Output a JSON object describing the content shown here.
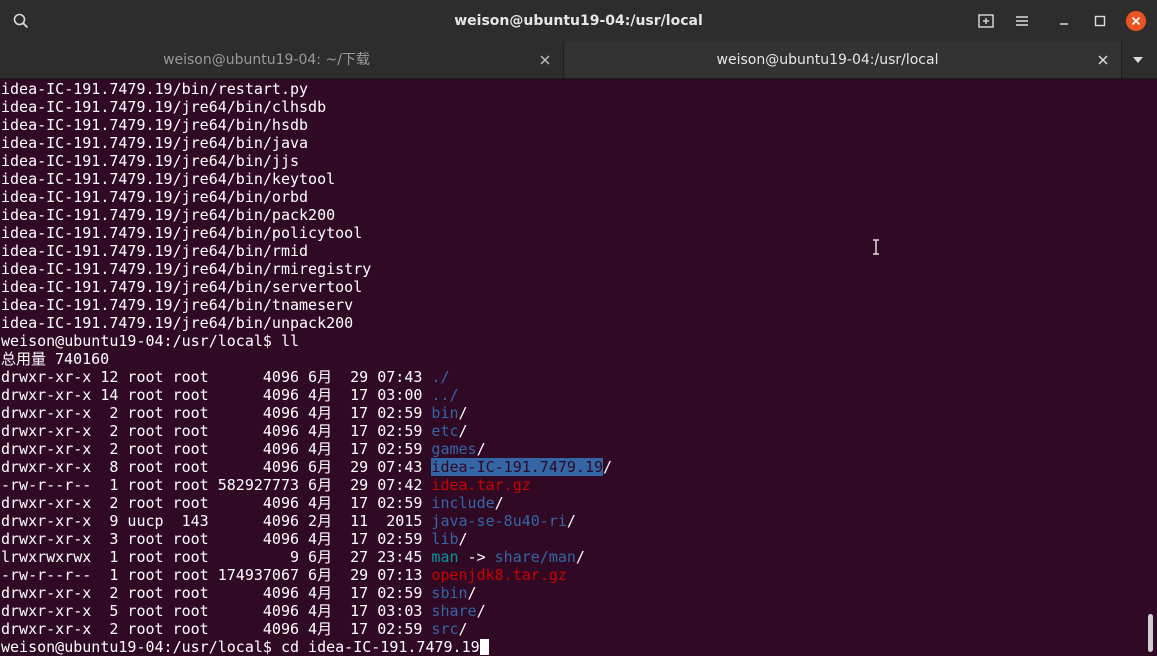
{
  "window": {
    "title": "weison@ubuntu19-04:/usr/local"
  },
  "tabs": [
    {
      "label": "weison@ubuntu19-04: ~/下载",
      "active": false
    },
    {
      "label": "weison@ubuntu19-04:/usr/local",
      "active": true
    }
  ],
  "terminal": {
    "file_lines": [
      "idea-IC-191.7479.19/bin/restart.py",
      "idea-IC-191.7479.19/jre64/bin/clhsdb",
      "idea-IC-191.7479.19/jre64/bin/hsdb",
      "idea-IC-191.7479.19/jre64/bin/java",
      "idea-IC-191.7479.19/jre64/bin/jjs",
      "idea-IC-191.7479.19/jre64/bin/keytool",
      "idea-IC-191.7479.19/jre64/bin/orbd",
      "idea-IC-191.7479.19/jre64/bin/pack200",
      "idea-IC-191.7479.19/jre64/bin/policytool",
      "idea-IC-191.7479.19/jre64/bin/rmid",
      "idea-IC-191.7479.19/jre64/bin/rmiregistry",
      "idea-IC-191.7479.19/jre64/bin/servertool",
      "idea-IC-191.7479.19/jre64/bin/tnameserv",
      "idea-IC-191.7479.19/jre64/bin/unpack200"
    ],
    "prompt_ll": "weison@ubuntu19-04:/usr/local$ ll",
    "total": "总用量 740160",
    "listing": [
      {
        "meta": "drwxr-xr-x 12 root root      4096 6月  29 07:43 ",
        "name": "./",
        "slash": "",
        "kind": "dir"
      },
      {
        "meta": "drwxr-xr-x 14 root root      4096 4月  17 03:00 ",
        "name": "../",
        "slash": "",
        "kind": "dir"
      },
      {
        "meta": "drwxr-xr-x  2 root root      4096 4月  17 02:59 ",
        "name": "bin",
        "slash": "/",
        "kind": "dir"
      },
      {
        "meta": "drwxr-xr-x  2 root root      4096 4月  17 02:59 ",
        "name": "etc",
        "slash": "/",
        "kind": "dir"
      },
      {
        "meta": "drwxr-xr-x  2 root root      4096 4月  17 02:59 ",
        "name": "games",
        "slash": "/",
        "kind": "dir"
      },
      {
        "meta": "drwxr-xr-x  8 root root      4096 6月  29 07:43 ",
        "name": "idea-IC-191.7479.19",
        "slash": "/",
        "kind": "selected"
      },
      {
        "meta": "-rw-r--r--  1 root root 582927773 6月  29 07:42 ",
        "name": "idea.tar.gz",
        "slash": "",
        "kind": "archive"
      },
      {
        "meta": "drwxr-xr-x  2 root root      4096 4月  17 02:59 ",
        "name": "include",
        "slash": "/",
        "kind": "dir"
      },
      {
        "meta": "drwxr-xr-x  9 uucp  143      4096 2月  11  2015 ",
        "name": "java-se-8u40-ri",
        "slash": "/",
        "kind": "dir"
      },
      {
        "meta": "drwxr-xr-x  3 root root      4096 4月  17 02:59 ",
        "name": "lib",
        "slash": "/",
        "kind": "dir"
      },
      {
        "meta": "lrwxrwxrwx  1 root root         9 6月  27 23:45 ",
        "name": "man",
        "slash": "",
        "kind": "link",
        "arrow": " -> ",
        "target": "share/man",
        "target_slash": "/"
      },
      {
        "meta": "-rw-r--r--  1 root root 174937067 6月  29 07:13 ",
        "name": "openjdk8.tar.gz",
        "slash": "",
        "kind": "archive"
      },
      {
        "meta": "drwxr-xr-x  2 root root      4096 4月  17 02:59 ",
        "name": "sbin",
        "slash": "/",
        "kind": "dir"
      },
      {
        "meta": "drwxr-xr-x  5 root root      4096 4月  17 03:03 ",
        "name": "share",
        "slash": "/",
        "kind": "dir"
      },
      {
        "meta": "drwxr-xr-x  2 root root      4096 4月  17 02:59 ",
        "name": "src",
        "slash": "/",
        "kind": "dir"
      }
    ],
    "prompt_cd": "weison@ubuntu19-04:/usr/local$ cd idea-IC-191.7479.19"
  },
  "colors": {
    "background": "#300a24",
    "directory": "#3465a4",
    "archive": "#cc0000",
    "symlink": "#06989a",
    "close_button": "#e95420"
  },
  "icons": [
    "search-icon",
    "new-tab-icon",
    "hamburger-menu-icon",
    "minimize-icon",
    "maximize-icon",
    "close-icon",
    "tab-close-icon",
    "tab-list-chevron-icon",
    "text-cursor-ibeam-icon"
  ]
}
